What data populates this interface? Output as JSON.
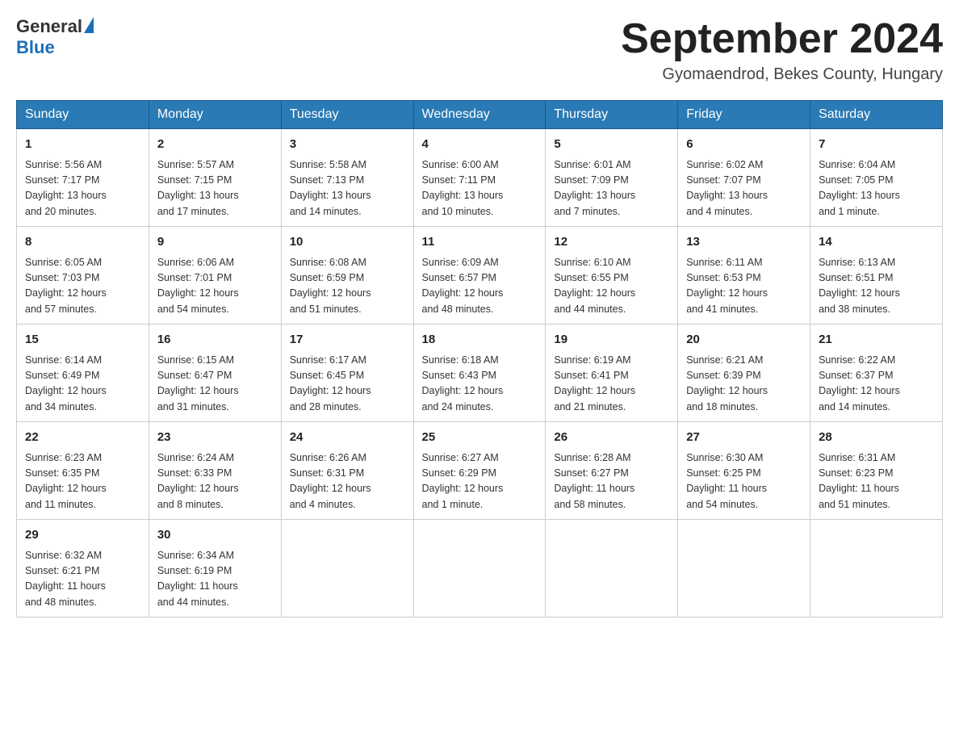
{
  "header": {
    "logo_general": "General",
    "logo_blue": "Blue",
    "month_title": "September 2024",
    "location": "Gyomaendrod, Bekes County, Hungary"
  },
  "calendar": {
    "days_of_week": [
      "Sunday",
      "Monday",
      "Tuesday",
      "Wednesday",
      "Thursday",
      "Friday",
      "Saturday"
    ],
    "weeks": [
      [
        {
          "day": "1",
          "info": "Sunrise: 5:56 AM\nSunset: 7:17 PM\nDaylight: 13 hours\nand 20 minutes."
        },
        {
          "day": "2",
          "info": "Sunrise: 5:57 AM\nSunset: 7:15 PM\nDaylight: 13 hours\nand 17 minutes."
        },
        {
          "day": "3",
          "info": "Sunrise: 5:58 AM\nSunset: 7:13 PM\nDaylight: 13 hours\nand 14 minutes."
        },
        {
          "day": "4",
          "info": "Sunrise: 6:00 AM\nSunset: 7:11 PM\nDaylight: 13 hours\nand 10 minutes."
        },
        {
          "day": "5",
          "info": "Sunrise: 6:01 AM\nSunset: 7:09 PM\nDaylight: 13 hours\nand 7 minutes."
        },
        {
          "day": "6",
          "info": "Sunrise: 6:02 AM\nSunset: 7:07 PM\nDaylight: 13 hours\nand 4 minutes."
        },
        {
          "day": "7",
          "info": "Sunrise: 6:04 AM\nSunset: 7:05 PM\nDaylight: 13 hours\nand 1 minute."
        }
      ],
      [
        {
          "day": "8",
          "info": "Sunrise: 6:05 AM\nSunset: 7:03 PM\nDaylight: 12 hours\nand 57 minutes."
        },
        {
          "day": "9",
          "info": "Sunrise: 6:06 AM\nSunset: 7:01 PM\nDaylight: 12 hours\nand 54 minutes."
        },
        {
          "day": "10",
          "info": "Sunrise: 6:08 AM\nSunset: 6:59 PM\nDaylight: 12 hours\nand 51 minutes."
        },
        {
          "day": "11",
          "info": "Sunrise: 6:09 AM\nSunset: 6:57 PM\nDaylight: 12 hours\nand 48 minutes."
        },
        {
          "day": "12",
          "info": "Sunrise: 6:10 AM\nSunset: 6:55 PM\nDaylight: 12 hours\nand 44 minutes."
        },
        {
          "day": "13",
          "info": "Sunrise: 6:11 AM\nSunset: 6:53 PM\nDaylight: 12 hours\nand 41 minutes."
        },
        {
          "day": "14",
          "info": "Sunrise: 6:13 AM\nSunset: 6:51 PM\nDaylight: 12 hours\nand 38 minutes."
        }
      ],
      [
        {
          "day": "15",
          "info": "Sunrise: 6:14 AM\nSunset: 6:49 PM\nDaylight: 12 hours\nand 34 minutes."
        },
        {
          "day": "16",
          "info": "Sunrise: 6:15 AM\nSunset: 6:47 PM\nDaylight: 12 hours\nand 31 minutes."
        },
        {
          "day": "17",
          "info": "Sunrise: 6:17 AM\nSunset: 6:45 PM\nDaylight: 12 hours\nand 28 minutes."
        },
        {
          "day": "18",
          "info": "Sunrise: 6:18 AM\nSunset: 6:43 PM\nDaylight: 12 hours\nand 24 minutes."
        },
        {
          "day": "19",
          "info": "Sunrise: 6:19 AM\nSunset: 6:41 PM\nDaylight: 12 hours\nand 21 minutes."
        },
        {
          "day": "20",
          "info": "Sunrise: 6:21 AM\nSunset: 6:39 PM\nDaylight: 12 hours\nand 18 minutes."
        },
        {
          "day": "21",
          "info": "Sunrise: 6:22 AM\nSunset: 6:37 PM\nDaylight: 12 hours\nand 14 minutes."
        }
      ],
      [
        {
          "day": "22",
          "info": "Sunrise: 6:23 AM\nSunset: 6:35 PM\nDaylight: 12 hours\nand 11 minutes."
        },
        {
          "day": "23",
          "info": "Sunrise: 6:24 AM\nSunset: 6:33 PM\nDaylight: 12 hours\nand 8 minutes."
        },
        {
          "day": "24",
          "info": "Sunrise: 6:26 AM\nSunset: 6:31 PM\nDaylight: 12 hours\nand 4 minutes."
        },
        {
          "day": "25",
          "info": "Sunrise: 6:27 AM\nSunset: 6:29 PM\nDaylight: 12 hours\nand 1 minute."
        },
        {
          "day": "26",
          "info": "Sunrise: 6:28 AM\nSunset: 6:27 PM\nDaylight: 11 hours\nand 58 minutes."
        },
        {
          "day": "27",
          "info": "Sunrise: 6:30 AM\nSunset: 6:25 PM\nDaylight: 11 hours\nand 54 minutes."
        },
        {
          "day": "28",
          "info": "Sunrise: 6:31 AM\nSunset: 6:23 PM\nDaylight: 11 hours\nand 51 minutes."
        }
      ],
      [
        {
          "day": "29",
          "info": "Sunrise: 6:32 AM\nSunset: 6:21 PM\nDaylight: 11 hours\nand 48 minutes."
        },
        {
          "day": "30",
          "info": "Sunrise: 6:34 AM\nSunset: 6:19 PM\nDaylight: 11 hours\nand 44 minutes."
        },
        {
          "day": "",
          "info": ""
        },
        {
          "day": "",
          "info": ""
        },
        {
          "day": "",
          "info": ""
        },
        {
          "day": "",
          "info": ""
        },
        {
          "day": "",
          "info": ""
        }
      ]
    ]
  }
}
